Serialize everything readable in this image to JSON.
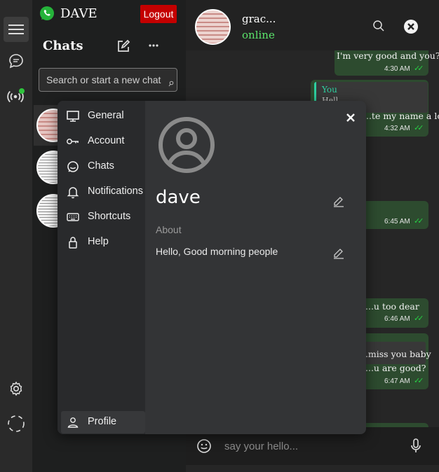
{
  "app": {
    "name": "DAVE",
    "logout_label": "Logout"
  },
  "chat_list": {
    "title": "Chats",
    "search_placeholder": "Search or start a new chat"
  },
  "conversation": {
    "contact_name": "grac...",
    "contact_status": "online",
    "messages": [
      {
        "text": "I'm very good and you?",
        "time": "4:30 AM"
      },
      {
        "reply_to": "You",
        "reply_text": "Hell",
        "text": "...te my name a lot",
        "time": "4:32 AM"
      },
      {
        "text": "",
        "time": "6:45 AM"
      },
      {
        "text": "...u too dear",
        "time": "6:46 AM"
      },
      {
        "text_line1": "...miss you baby",
        "text_line2": "...u are good?",
        "time": "6:47 AM"
      }
    ],
    "composer_placeholder": "say your hello..."
  },
  "settings": {
    "nav": [
      "General",
      "Account",
      "Chats",
      "Notifications",
      "Shortcuts",
      "Help"
    ],
    "profile_nav": "Profile",
    "profile_name": "dave",
    "about_label": "About",
    "about_text": "Hello,  Good morning people"
  },
  "colors": {
    "accent_green": "#27d045",
    "logout_red": "#c40000",
    "online_green": "#5be46b"
  }
}
